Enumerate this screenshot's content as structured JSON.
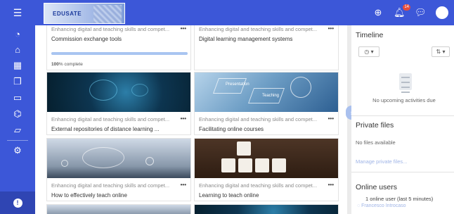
{
  "navbar": {
    "logo_text": "EDUSATE",
    "notification_count": "14",
    "icons": [
      "menu-icon",
      "globe-icon",
      "bell-icon",
      "chat-icon",
      "user-avatar"
    ]
  },
  "sidebar": {
    "icons": [
      "dashboard-icon",
      "home-icon",
      "calendar-icon",
      "files-icon",
      "clipboard-icon",
      "graduation-cap-icon",
      "folder-icon",
      "gear-icon",
      "info-icon"
    ]
  },
  "courses": [
    {
      "category": "Enhancing digital and teaching skills and compet...",
      "title": "Commission exchange tools",
      "progress": 100,
      "progress_label": "100",
      "progress_suffix": "% complete"
    },
    {
      "category": "Enhancing digital and teaching skills and compet...",
      "title": "Digital learning management systems"
    },
    {
      "category": "Enhancing digital and teaching skills and compet...",
      "title": "External repositories of distance learning ..."
    },
    {
      "category": "Enhancing digital and teaching skills and compet...",
      "title": "Facilitating online courses",
      "image_labels": [
        "Presentation",
        "Teaching"
      ]
    },
    {
      "category": "Enhancing digital and teaching skills and compet...",
      "title": "How to effectively teach online"
    },
    {
      "category": "Enhancing digital and teaching skills and compet...",
      "title": "Learning to teach online"
    }
  ],
  "drawer": {
    "timeline": {
      "heading": "Timeline",
      "empty": "No upcoming activities due"
    },
    "private_files": {
      "heading": "Private files",
      "empty": "No files available",
      "manage_link": "Manage private files..."
    },
    "online_users": {
      "heading": "Online users",
      "summary": "1 online user (last 5 minutes)",
      "user": "Francesco Introcaso"
    }
  },
  "colors": {
    "brand": "#3c57d8",
    "progress": "#a9c5f1",
    "link": "#9fb4e6"
  }
}
